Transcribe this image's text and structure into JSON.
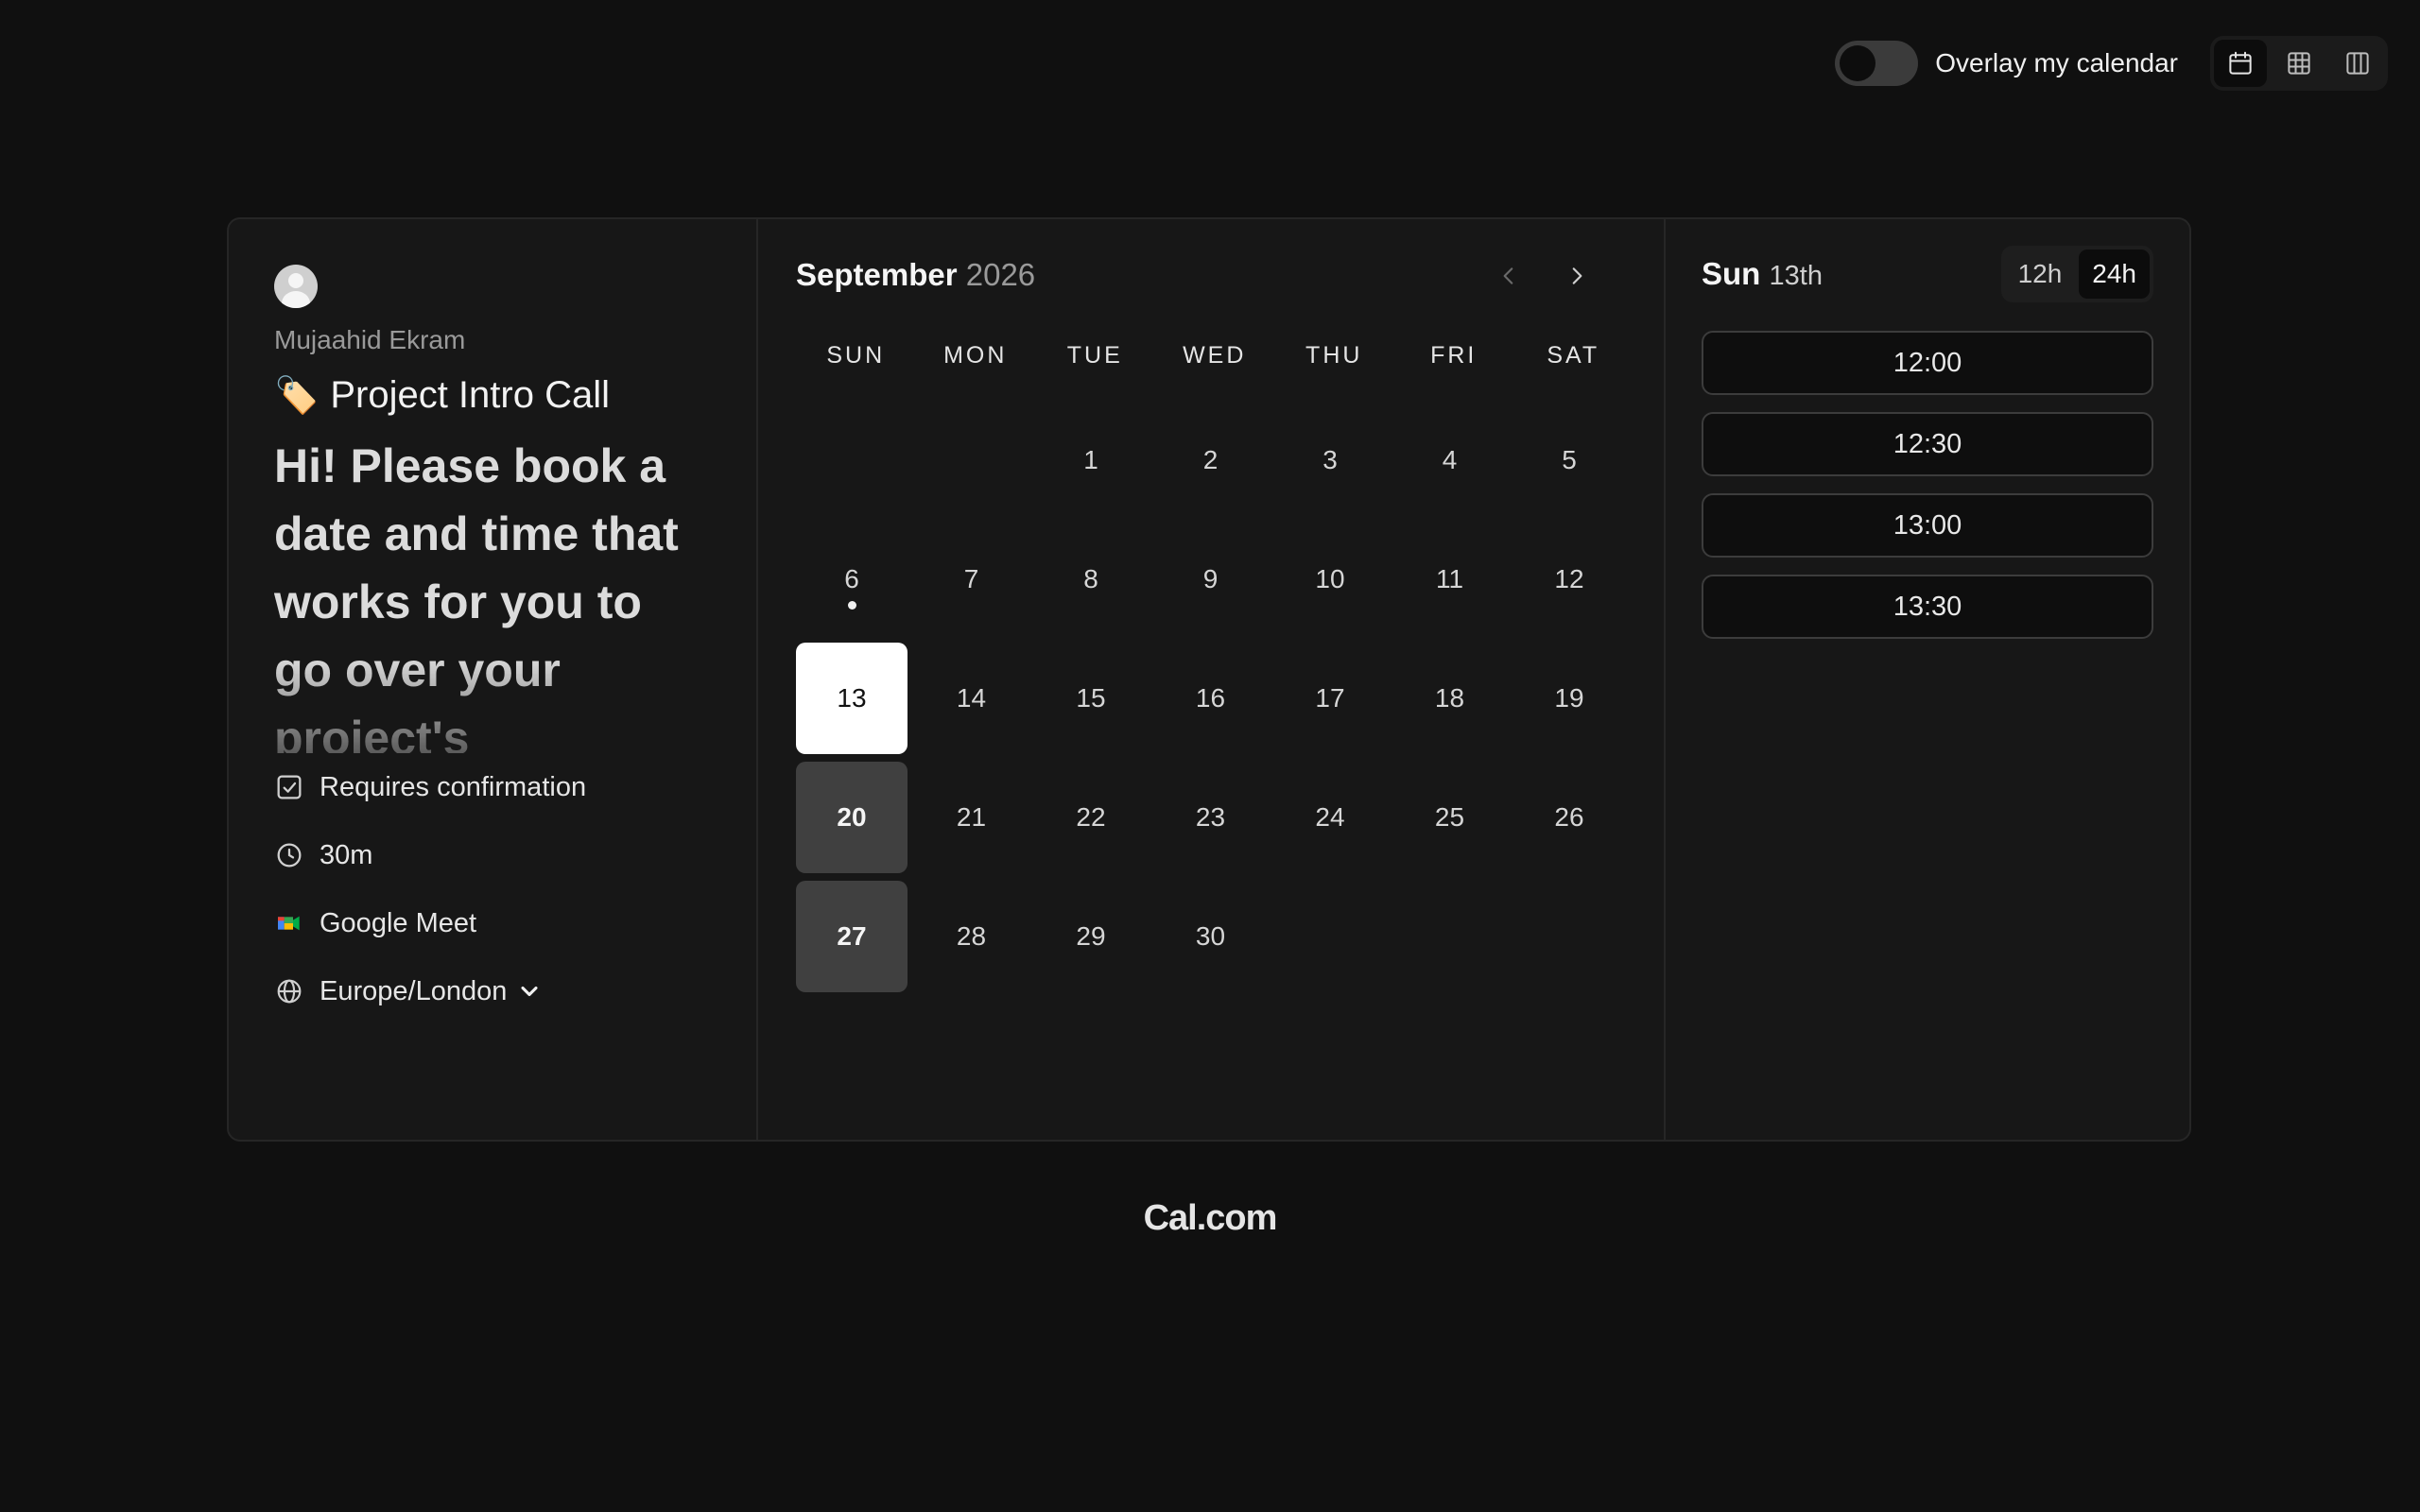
{
  "topbar": {
    "overlay_label": "Overlay my calendar",
    "overlay_enabled": false,
    "views": [
      {
        "icon": "calendar-icon",
        "active": true
      },
      {
        "icon": "grid-icon",
        "active": false
      },
      {
        "icon": "columns-icon",
        "active": false
      }
    ]
  },
  "event": {
    "host_name": "Mujaahid Ekram",
    "title_emoji": "🏷️",
    "title": "Project Intro Call",
    "description": "Hi! Please book a date and time that works for you to go over your project's",
    "details": {
      "confirmation": "Requires confirmation",
      "duration": "30m",
      "location": "Google Meet",
      "timezone": "Europe/London"
    }
  },
  "calendar": {
    "month": "September",
    "year": "2026",
    "weekdays": [
      "SUN",
      "MON",
      "TUE",
      "WED",
      "THU",
      "FRI",
      "SAT"
    ],
    "first_weekday_index": 2,
    "days_in_month": 30,
    "today": 6,
    "selected": 13,
    "available": [
      13,
      20,
      27
    ]
  },
  "slots_panel": {
    "weekday": "Sun",
    "day_label": "13th",
    "format_12h": "12h",
    "format_24h": "24h",
    "active_format": "24h",
    "slots": [
      "12:00",
      "12:30",
      "13:00",
      "13:30"
    ]
  },
  "footer": {
    "brand": "Cal.com"
  },
  "colors": {
    "background": "#101010",
    "card": "#171717",
    "selected_day": "#ffffff",
    "available_day": "#404040"
  }
}
